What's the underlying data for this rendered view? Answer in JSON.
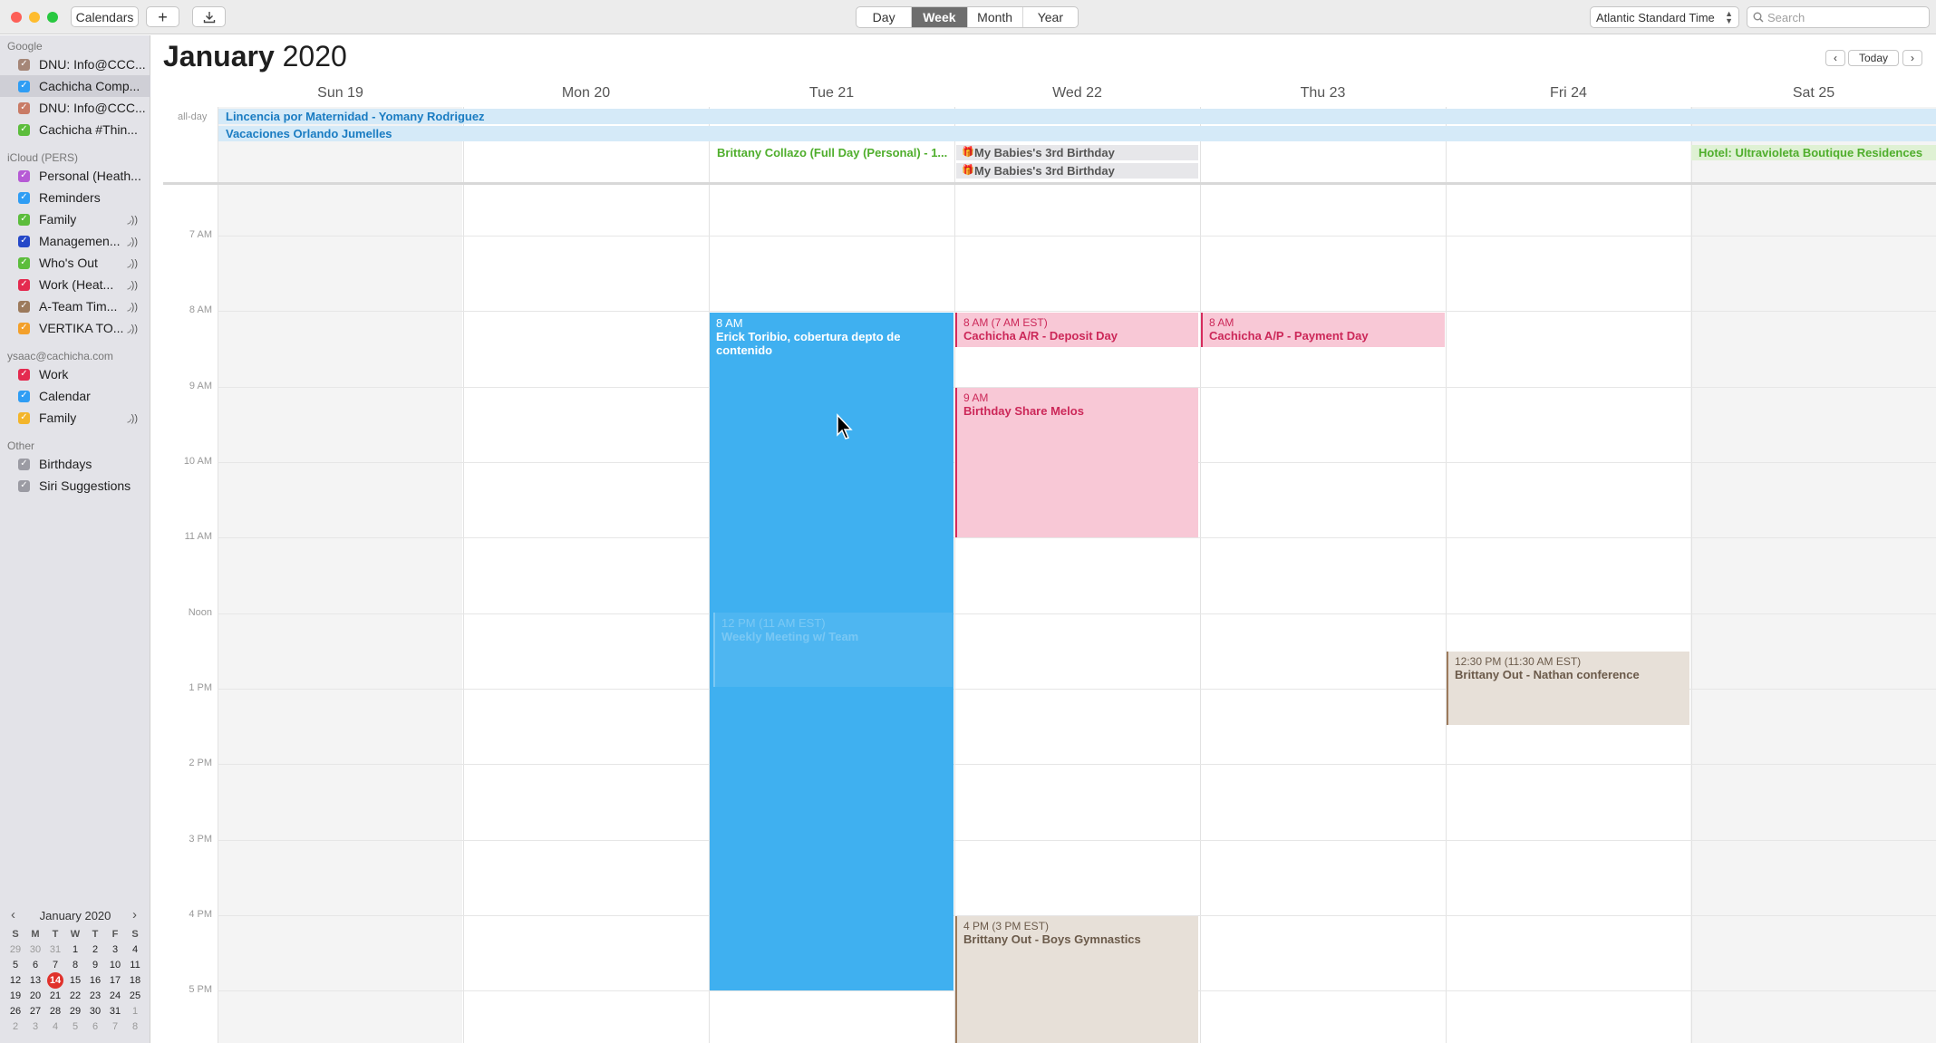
{
  "toolbar": {
    "calendars_label": "Calendars",
    "add_icon": "plus-icon",
    "import_icon": "download-icon",
    "views": [
      "Day",
      "Week",
      "Month",
      "Year"
    ],
    "active_view": "Week",
    "timezone": "Atlantic Standard Time",
    "search_placeholder": "Search"
  },
  "sidebar": {
    "groups": [
      {
        "title": "Google",
        "items": [
          {
            "label": "DNU: Info@CCC...",
            "color": "#a58677",
            "shared": false,
            "selected": false
          },
          {
            "label": "Cachicha Comp...",
            "color": "#2f9df4",
            "shared": false,
            "selected": true
          },
          {
            "label": "DNU: Info@CCC...",
            "color": "#c97b66",
            "shared": false,
            "selected": false
          },
          {
            "label": "Cachicha #Thin...",
            "color": "#5cbd3c",
            "shared": false,
            "selected": false
          }
        ]
      },
      {
        "title": "iCloud (PERS)",
        "items": [
          {
            "label": "Personal (Heath...",
            "color": "#b65ad5",
            "shared": false,
            "selected": false
          },
          {
            "label": "Reminders",
            "color": "#2f9df4",
            "shared": false,
            "selected": false
          },
          {
            "label": "Family",
            "color": "#5cbd3c",
            "shared": true,
            "selected": false
          },
          {
            "label": "Managemen...",
            "color": "#2548c8",
            "shared": true,
            "selected": false
          },
          {
            "label": "Who's Out",
            "color": "#5cbd3c",
            "shared": true,
            "selected": false
          },
          {
            "label": "Work (Heat...",
            "color": "#e42a4f",
            "shared": true,
            "selected": false
          },
          {
            "label": "A-Team Tim...",
            "color": "#9c7a5c",
            "shared": true,
            "selected": false
          },
          {
            "label": "VERTIKA TO...",
            "color": "#f3a02b",
            "shared": true,
            "selected": false
          }
        ]
      },
      {
        "title": "ysaac@cachicha.com",
        "items": [
          {
            "label": "Work",
            "color": "#e42a4f",
            "shared": false,
            "selected": false
          },
          {
            "label": "Calendar",
            "color": "#2f9df4",
            "shared": false,
            "selected": false
          },
          {
            "label": "Family",
            "color": "#f3b52b",
            "shared": true,
            "selected": false
          }
        ]
      },
      {
        "title": "Other",
        "items": [
          {
            "label": "Birthdays",
            "color": "#9b9ba3",
            "shared": false,
            "selected": false
          },
          {
            "label": "Siri Suggestions",
            "color": "#9b9ba3",
            "shared": false,
            "selected": false
          }
        ]
      }
    ]
  },
  "mini_calendar": {
    "title": "January 2020",
    "weekdays": [
      "S",
      "M",
      "T",
      "W",
      "T",
      "F",
      "S"
    ],
    "weeks": [
      [
        "29",
        "30",
        "31",
        "1",
        "2",
        "3",
        "4"
      ],
      [
        "5",
        "6",
        "7",
        "8",
        "9",
        "10",
        "11"
      ],
      [
        "12",
        "13",
        "14",
        "15",
        "16",
        "17",
        "18"
      ],
      [
        "19",
        "20",
        "21",
        "22",
        "23",
        "24",
        "25"
      ],
      [
        "26",
        "27",
        "28",
        "29",
        "30",
        "31",
        "1"
      ],
      [
        "2",
        "3",
        "4",
        "5",
        "6",
        "7",
        "8"
      ]
    ],
    "today": "14"
  },
  "header": {
    "month": "January",
    "year": "2020",
    "today_label": "Today"
  },
  "days": [
    "Sun 19",
    "Mon 20",
    "Tue 21",
    "Wed 22",
    "Thu 23",
    "Fri 24",
    "Sat 25"
  ],
  "allday_label": "all-day",
  "allday_events": [
    {
      "title": "Lincencia por Maternidad - Yomany Rodriguez",
      "color": "#1a7cc2"
    },
    {
      "title": "Vacaciones Orlando Jumelles",
      "color": "#1a7cc2"
    },
    {
      "title": "Brittany Collazo (Full Day (Personal) - 1...",
      "color": "#4fae2c"
    },
    {
      "title": "My Babies's 3rd Birthday",
      "color": "#555555"
    },
    {
      "title": "My Babies's 3rd Birthday",
      "color": "#555555"
    },
    {
      "title": "Hotel: Ultravioleta Boutique Residences",
      "color": "#4fae2c"
    }
  ],
  "time_labels": [
    "7 AM",
    "8 AM",
    "9 AM",
    "10 AM",
    "11 AM",
    "Noon",
    "1 PM",
    "2 PM",
    "3 PM",
    "4 PM",
    "5 PM"
  ],
  "events": [
    {
      "time": "8 AM",
      "title": "Erick Toribio, cobertura depto de contenido",
      "day": "Tue 21"
    },
    {
      "time": "8 AM (7 AM EST)",
      "title": "Cachicha A/R - Deposit Day",
      "day": "Wed 22"
    },
    {
      "time": "8 AM",
      "title": "Cachicha A/P - Payment Day",
      "day": "Thu 23"
    },
    {
      "time": "9 AM",
      "title": "Birthday Share Melos",
      "day": "Wed 22"
    },
    {
      "time": "12:30 PM (11:30 AM EST)",
      "title": "Brittany Out - Nathan conference",
      "day": "Fri 24"
    },
    {
      "time": "4 PM (3 PM EST)",
      "title": "Brittany Out - Boys Gymnastics",
      "day": "Wed 22"
    },
    {
      "time": "12 PM (11 AM EST)",
      "title": "Weekly Meeting w/ Team",
      "day": "Tue 21"
    }
  ]
}
